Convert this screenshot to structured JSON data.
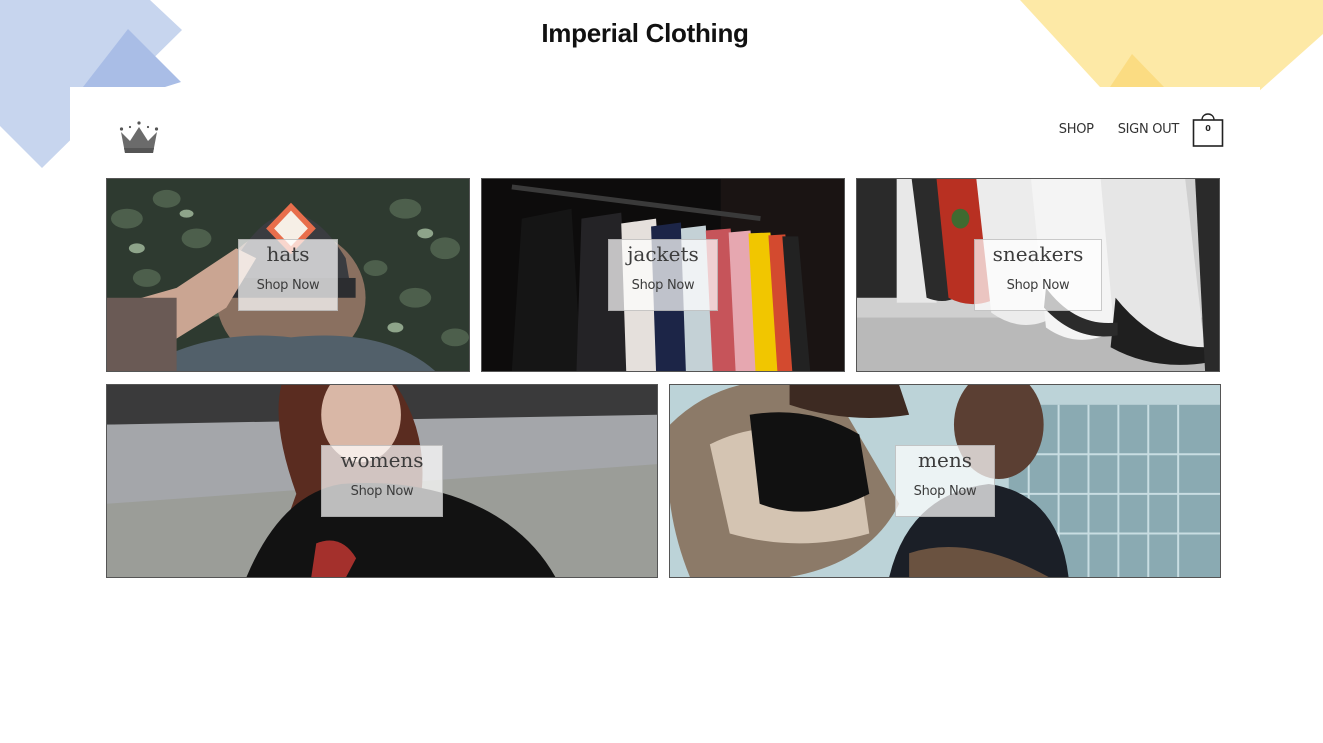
{
  "header": {
    "title": "Imperial Clothing"
  },
  "nav": {
    "logo_icon": "crown-icon",
    "shop_label": "SHOP",
    "signout_label": "SIGN OUT",
    "cart_icon": "shopping-bag-icon",
    "cart_count": "0"
  },
  "directory": [
    {
      "title": "hats",
      "cta": "Shop Now"
    },
    {
      "title": "jackets",
      "cta": "Shop Now"
    },
    {
      "title": "sneakers",
      "cta": "Shop Now"
    },
    {
      "title": "womens",
      "cta": "Shop Now"
    },
    {
      "title": "mens",
      "cta": "Shop Now"
    }
  ],
  "colors": {
    "deco_blue": "#c7d5ee",
    "deco_blue_dark": "#a9bde6",
    "deco_yellow": "#fde9a6",
    "deco_yellow_dark": "#fbdc82",
    "text": "#333333"
  }
}
